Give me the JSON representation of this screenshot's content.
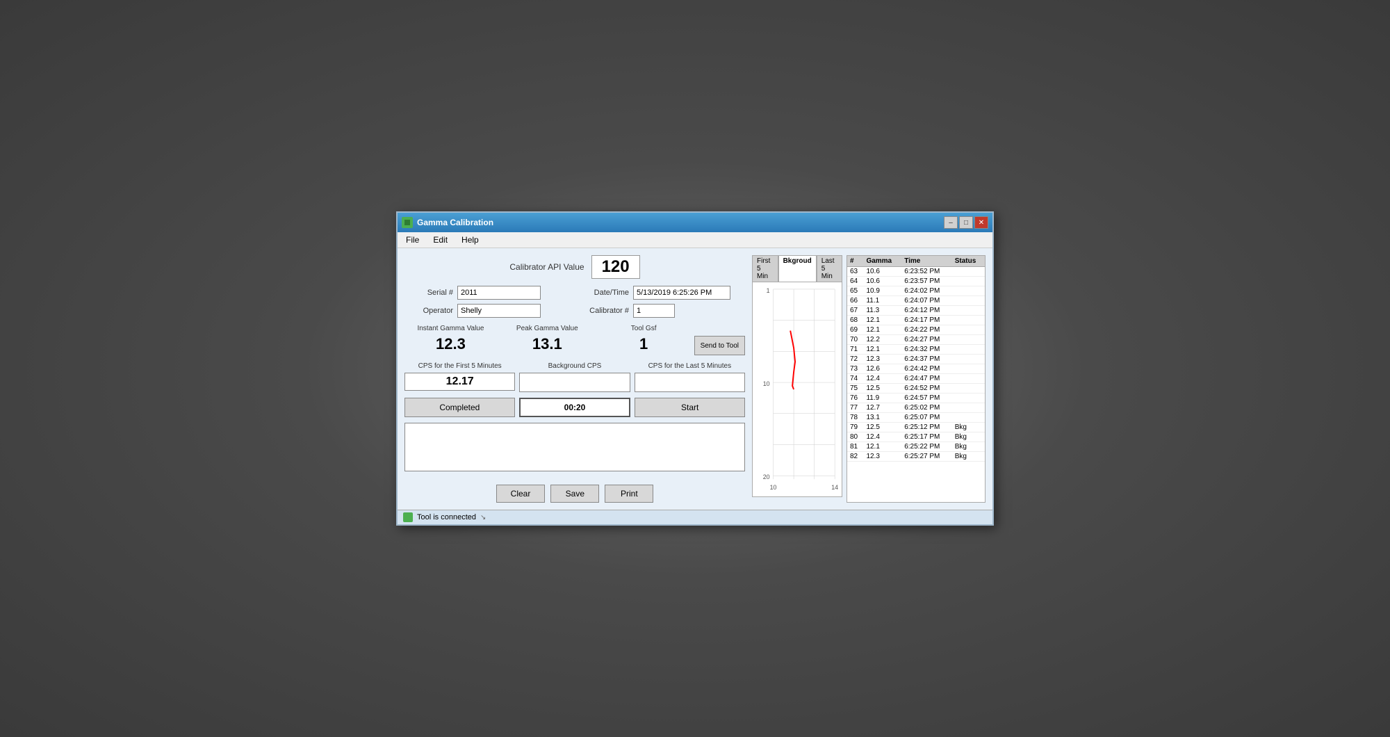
{
  "window": {
    "title": "Gamma Calibration",
    "status": "Tool is connected"
  },
  "menu": {
    "items": [
      "File",
      "Edit",
      "Help"
    ]
  },
  "calibrator_api": {
    "label": "Calibrator API Value",
    "value": "120"
  },
  "form": {
    "serial_label": "Serial #",
    "serial_value": "2011",
    "operator_label": "Operator",
    "operator_value": "Shelly",
    "datetime_label": "Date/Time",
    "datetime_value": "5/13/2019 6:25:26 PM",
    "calibrator_label": "Calibrator #",
    "calibrator_value": "1"
  },
  "measurements": {
    "instant_gamma_label": "Instant Gamma Value",
    "instant_gamma_value": "12.3",
    "peak_gamma_label": "Peak Gamma Value",
    "peak_gamma_value": "13.1",
    "tool_gsf_label": "Tool Gsf",
    "tool_gsf_value": "1",
    "send_to_tool_label": "Send to Tool"
  },
  "cps": {
    "first5_label": "CPS for the First 5 Minutes",
    "first5_value": "12.17",
    "background_label": "Background CPS",
    "background_value": "",
    "last5_label": "CPS for the Last 5 Minutes",
    "last5_value": ""
  },
  "buttons": {
    "completed": "Completed",
    "timer": "00:20",
    "start": "Start",
    "clear": "Clear",
    "save": "Save",
    "print": "Print"
  },
  "tabs": {
    "first5": "First 5 Min",
    "bkgroud": "Bkgroud",
    "last5": "Last 5 Min"
  },
  "chart": {
    "y_labels": [
      "1",
      "10",
      "20"
    ],
    "x_min": "10",
    "x_max": "14"
  },
  "table": {
    "headers": [
      "#",
      "Gamma",
      "Time",
      "Status"
    ],
    "rows": [
      {
        "num": "63",
        "gamma": "10.6",
        "time": "6:23:52 PM",
        "status": ""
      },
      {
        "num": "64",
        "gamma": "10.6",
        "time": "6:23:57 PM",
        "status": ""
      },
      {
        "num": "65",
        "gamma": "10.9",
        "time": "6:24:02 PM",
        "status": ""
      },
      {
        "num": "66",
        "gamma": "11.1",
        "time": "6:24:07 PM",
        "status": ""
      },
      {
        "num": "67",
        "gamma": "11.3",
        "time": "6:24:12 PM",
        "status": ""
      },
      {
        "num": "68",
        "gamma": "12.1",
        "time": "6:24:17 PM",
        "status": ""
      },
      {
        "num": "69",
        "gamma": "12.1",
        "time": "6:24:22 PM",
        "status": ""
      },
      {
        "num": "70",
        "gamma": "12.2",
        "time": "6:24:27 PM",
        "status": ""
      },
      {
        "num": "71",
        "gamma": "12.1",
        "time": "6:24:32 PM",
        "status": ""
      },
      {
        "num": "72",
        "gamma": "12.3",
        "time": "6:24:37 PM",
        "status": ""
      },
      {
        "num": "73",
        "gamma": "12.6",
        "time": "6:24:42 PM",
        "status": ""
      },
      {
        "num": "74",
        "gamma": "12.4",
        "time": "6:24:47 PM",
        "status": ""
      },
      {
        "num": "75",
        "gamma": "12.5",
        "time": "6:24:52 PM",
        "status": ""
      },
      {
        "num": "76",
        "gamma": "11.9",
        "time": "6:24:57 PM",
        "status": ""
      },
      {
        "num": "77",
        "gamma": "12.7",
        "time": "6:25:02 PM",
        "status": ""
      },
      {
        "num": "78",
        "gamma": "13.1",
        "time": "6:25:07 PM",
        "status": ""
      },
      {
        "num": "79",
        "gamma": "12.5",
        "time": "6:25:12 PM",
        "status": "Bkg"
      },
      {
        "num": "80",
        "gamma": "12.4",
        "time": "6:25:17 PM",
        "status": "Bkg"
      },
      {
        "num": "81",
        "gamma": "12.1",
        "time": "6:25:22 PM",
        "status": "Bkg"
      },
      {
        "num": "82",
        "gamma": "12.3",
        "time": "6:25:27 PM",
        "status": "Bkg"
      }
    ]
  }
}
